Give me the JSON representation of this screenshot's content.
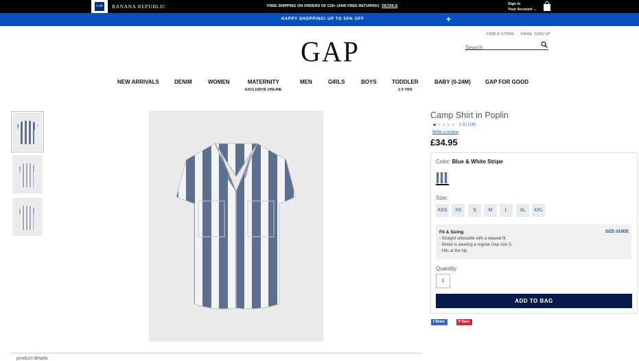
{
  "topbar": {
    "gap_mini_logo": "GAP",
    "brand": "BANANA REPUBLIC",
    "free_shipping": "FREE SHIPPING ON ORDERS OF £29+ (AND FREE RETURNS!)",
    "details": "DETAILS",
    "signin_line1": "Sign In",
    "signin_line2": "Your Account"
  },
  "promo": {
    "text": "HAPPY SHOPPING! UP TO 50% OFF",
    "expand": "+"
  },
  "header": {
    "find_store": "FIND A STORE",
    "email_signup": "EMAIL SIGN UP",
    "logo": "GAP",
    "search_placeholder": "Search"
  },
  "nav": {
    "items": [
      {
        "label": "NEW ARRIVALS",
        "sub": ""
      },
      {
        "label": "DENIM",
        "sub": ""
      },
      {
        "label": "WOMEN",
        "sub": ""
      },
      {
        "label": "MATERNITY",
        "sub": "EXCLUSIVE ONLINE"
      },
      {
        "label": "MEN",
        "sub": ""
      },
      {
        "label": "GIRLS",
        "sub": ""
      },
      {
        "label": "BOYS",
        "sub": ""
      },
      {
        "label": "TODDLER",
        "sub": "1-5 YRS"
      },
      {
        "label": "BABY (0-24M)",
        "sub": ""
      },
      {
        "label": "GAP FOR GOOD",
        "sub": ""
      }
    ]
  },
  "product": {
    "title": "Camp Shirt in Poplin",
    "rating_text": "1.3  |  (16)",
    "stars_total": 5,
    "stars_on": 1,
    "write_review": "Write a review",
    "price": "£34.95",
    "color_label": "Color:",
    "color_value": "Blue & White Stripe",
    "size_label": "Size:",
    "sizes": [
      "XXS",
      "XS",
      "S",
      "M",
      "L",
      "XL",
      "XXL"
    ],
    "fit_title": "Fit & Sizing",
    "size_guide": "SIZE GUIDE",
    "fit_lines": [
      "- Straight silhouette with a relaxed fit.",
      "- Model is wearing a regular Gap size S.",
      "- Hits at the hip."
    ],
    "quantity_label": "Quantity:",
    "quantity": "1",
    "add_to_bag": "ADD TO BAG",
    "share": "Share",
    "save": "Save",
    "product_details": "product details"
  },
  "colors": {
    "topbar": "#000000",
    "promo": "#0a4fc0",
    "add_button": "#061a4b",
    "stripe_blue": "#5d6f8e",
    "facebook": "#3b66c4",
    "pinterest": "#d8233a"
  },
  "icons": [
    "bag-icon",
    "plus-icon",
    "search-icon",
    "star-icon",
    "facebook-icon",
    "pinterest-icon"
  ]
}
